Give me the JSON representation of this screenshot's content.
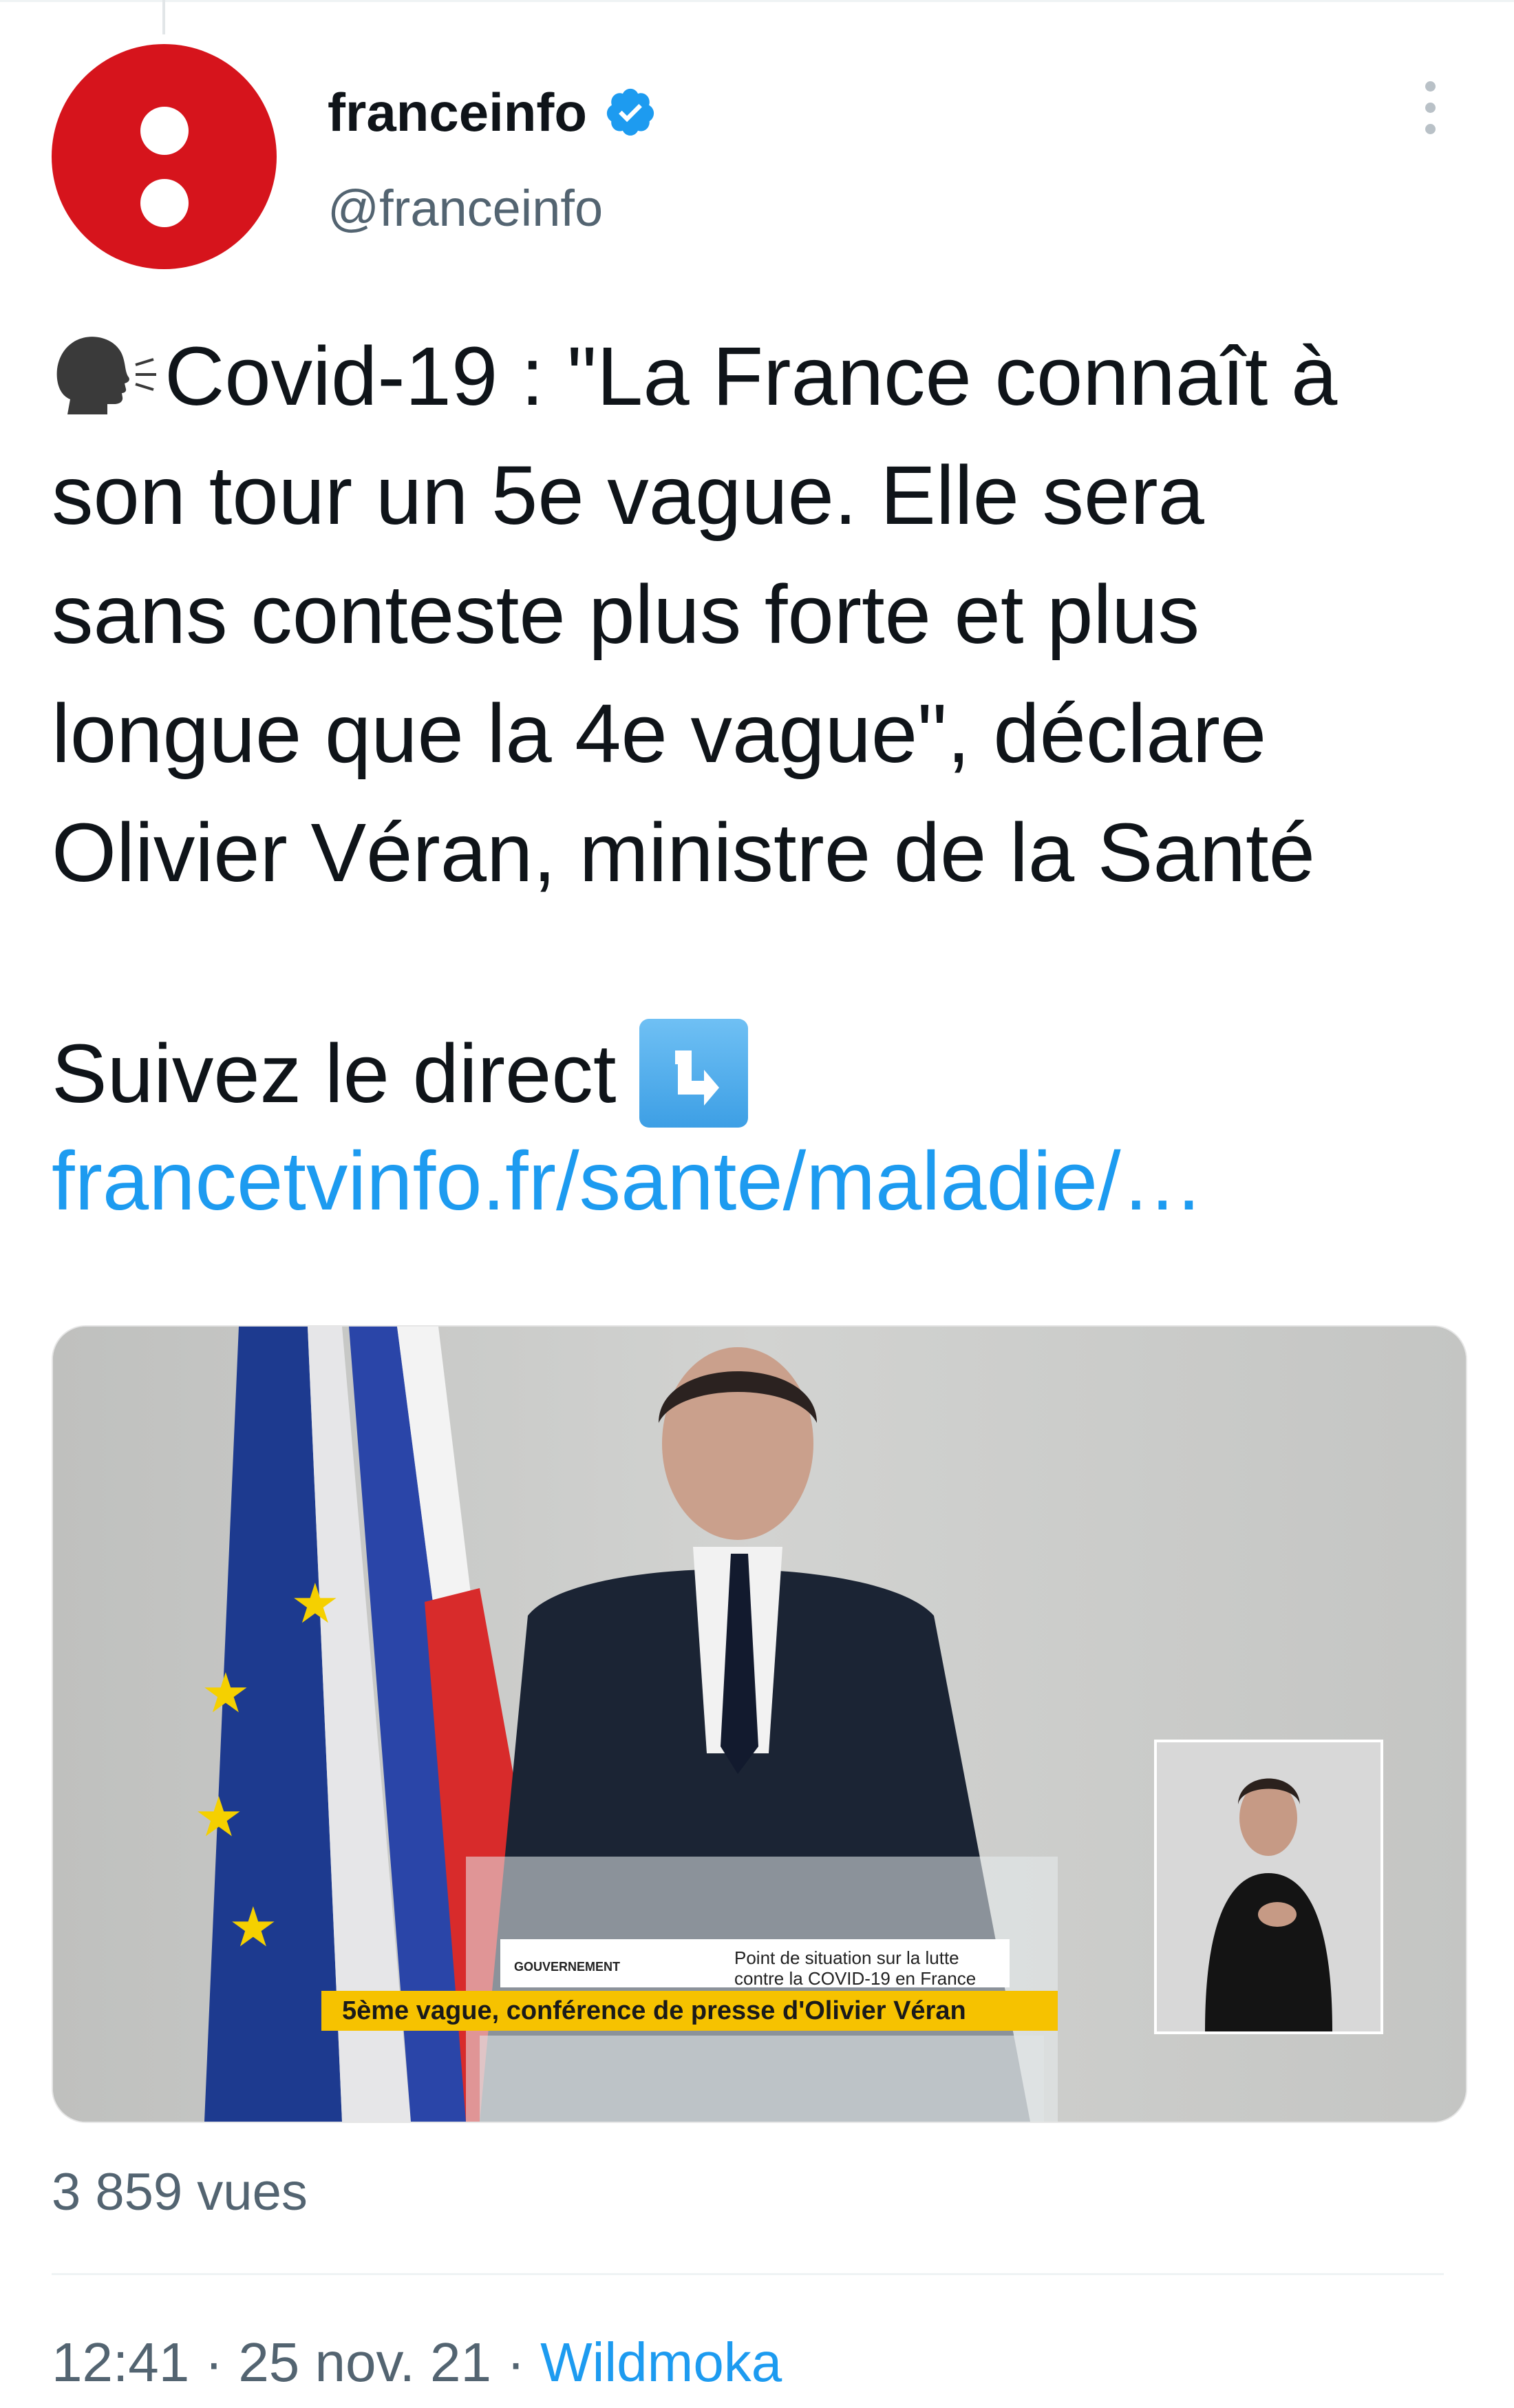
{
  "author": {
    "name": "franceinfo",
    "handle": "@franceinfo",
    "verified": true,
    "avatar_color": "#d6141c"
  },
  "tweet": {
    "speaking_icon": "speaking-head-icon",
    "text": "Covid-19 : \"La France connaît à\nson tour un 5e vague. Elle sera\nsans conteste plus forte et plus\nlongue que la 4e vague\", déclare\nOlivier Véran, ministre de la Santé",
    "follow_text": "Suivez le direct",
    "follow_icon": "down-right-arrow-icon",
    "link": "francetvinfo.fr/sante/maladie/…"
  },
  "media": {
    "caption": "5ème vague, conférence de presse d'Olivier Véran",
    "sign_gov": "GOUVERNEMENT",
    "sign_text": "Point de situation sur la lutte contre la COVID-19 en France",
    "caption_color": "#f6c200"
  },
  "stats": {
    "views": "3 859 vues"
  },
  "meta": {
    "time": "12:41",
    "separator": "·",
    "date": "25 nov. 21",
    "source": "Wildmoka"
  },
  "colors": {
    "link": "#1d9bf0",
    "secondary": "#536471",
    "text": "#0f1419"
  }
}
